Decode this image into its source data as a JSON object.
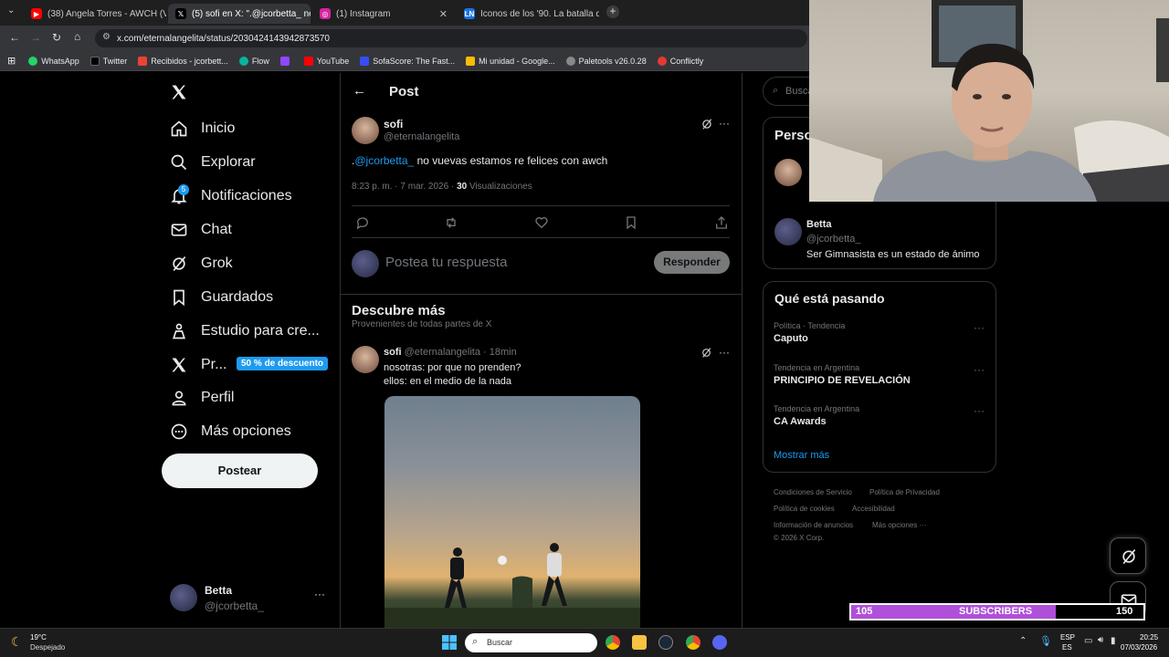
{
  "browser": {
    "tabs": [
      {
        "title": "(38) Angela Torres - AWCH (Vid",
        "favicon_color": "#ff0000"
      },
      {
        "title": "(5) sofi en X: \".@jcorbetta_ no v",
        "favicon_color": "#ffffff"
      },
      {
        "title": "(1) Instagram",
        "favicon_color": "#d6249f"
      },
      {
        "title": "Iconos de los '90. La batalla de",
        "favicon_color": "#1a73e8"
      }
    ],
    "url": "x.com/eternalangelita/status/2030424143942873570",
    "bookmarks": [
      "WhatsApp",
      "Twitter",
      "Recibidos - jcorbett...",
      "Flow",
      "",
      "YouTube",
      "SofaScore: The Fast...",
      "Mi unidad - Google...",
      "Paletools v26.0.28",
      "Conflictly"
    ]
  },
  "sidebar": {
    "items": [
      {
        "label": "Inicio",
        "icon": "home-icon"
      },
      {
        "label": "Explorar",
        "icon": "search-icon"
      },
      {
        "label": "Notificaciones",
        "icon": "bell-icon",
        "badge": "5"
      },
      {
        "label": "Chat",
        "icon": "mail-icon"
      },
      {
        "label": "Grok",
        "icon": "grok-icon"
      },
      {
        "label": "Guardados",
        "icon": "bookmark-icon"
      },
      {
        "label": "Estudio para cre...",
        "icon": "creator-studio-icon"
      },
      {
        "label": "Pr...",
        "icon": "x-logo-icon",
        "promo": "50 % de descuento"
      },
      {
        "label": "Perfil",
        "icon": "person-icon"
      },
      {
        "label": "Más opciones",
        "icon": "more-icon"
      }
    ],
    "post_button": "Postear",
    "account": {
      "name": "Betta",
      "handle": "@jcorbetta_"
    }
  },
  "main": {
    "header": "Post",
    "post": {
      "author": "sofi",
      "handle": "@eternalangelita",
      "text_prefix": ".",
      "mention": "@jcorbetta_",
      "text": " no vuevas estamos re felices con awch",
      "time": "8:23 p. m. · 7 mar. 2026 · ",
      "views_count": "30",
      "views_label": " Visualizaciones"
    },
    "reply": {
      "placeholder": "Postea tu respuesta",
      "button": "Responder"
    },
    "discover": {
      "title": "Descubre más",
      "subtitle": "Provenientes de todas partes de X",
      "tweet": {
        "author": "sofi",
        "handle": "@eternalangelita",
        "time": "· 18min",
        "line1": "nosotras: por que no prenden?",
        "line2": "ellos: en el medio de la nada"
      }
    }
  },
  "right": {
    "search_placeholder": "Busca",
    "who_to_follow_title": "Perso",
    "suggestion": {
      "name": "Betta",
      "handle": "@jcorbetta_",
      "bio": "Ser Gimnasista es un estado de ánimo"
    },
    "trends_title": "Qué está pasando",
    "trends": [
      {
        "context": "Política · Tendencia",
        "name": "Caputo"
      },
      {
        "context": "Tendencia en Argentina",
        "name": "PRINCIPIO DE REVELACIÓN"
      },
      {
        "context": "Tendencia en Argentina",
        "name": "CA Awards"
      }
    ],
    "show_more": "Mostrar más",
    "footer": [
      "Condiciones de Servicio",
      "Política de Privacidad",
      "Política de cookies",
      "Accesibilidad",
      "Información de anuncios",
      "Más opciones ···",
      "© 2026 X Corp."
    ]
  },
  "overlay": {
    "subs_current": "105",
    "subs_label": "SUBSCRIBERS",
    "subs_goal": "150",
    "subs_fraction": 0.7
  },
  "taskbar": {
    "weather_temp": "19°C",
    "weather_desc": "Despejado",
    "search": "Buscar",
    "lang1": "ESP",
    "lang2": "ES",
    "time": "20:25",
    "date": "07/03/2026"
  }
}
